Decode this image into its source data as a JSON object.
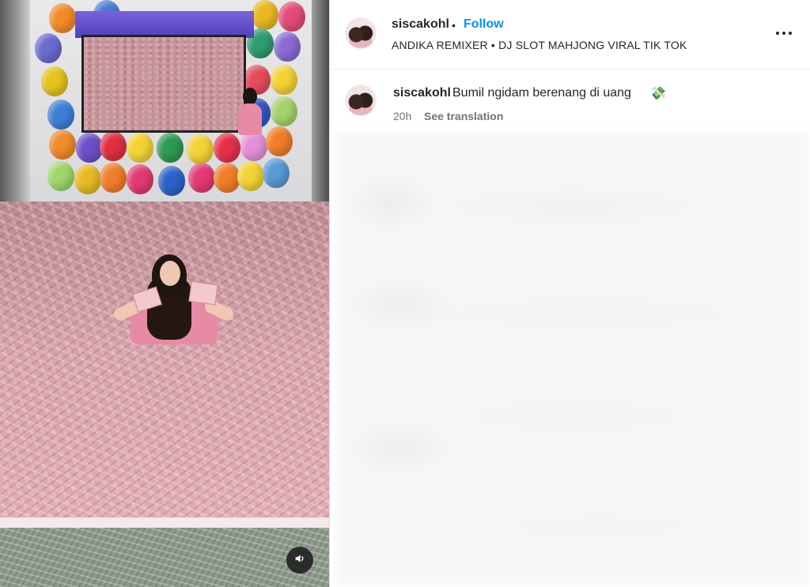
{
  "post": {
    "header": {
      "username": "siscakohl",
      "separator": "•",
      "follow_label": "Follow",
      "audio": "ANDIKA REMIXER • DJ SLOT MAHJONG VIRAL TIK TOK",
      "more_icon": "more-options-icon"
    },
    "caption": {
      "username": "siscakohl",
      "text": "Bumil ngidam berenang di uang",
      "emoji": "💸",
      "time": "20h",
      "translate_label": "See translation"
    },
    "media": {
      "sound_icon": "speaker-icon"
    }
  },
  "colors": {
    "accent": "#0095f6",
    "text": "#262626",
    "muted": "#737373"
  }
}
